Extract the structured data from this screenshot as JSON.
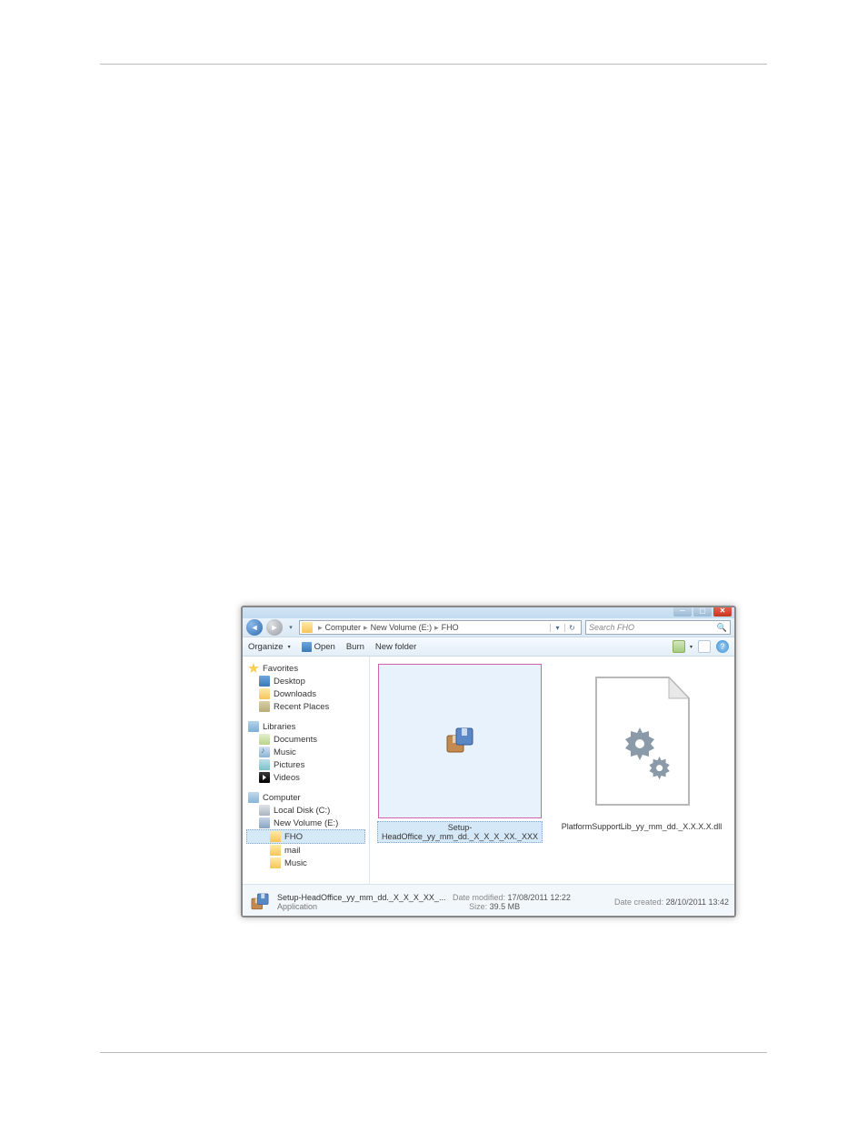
{
  "window": {
    "breadcrumb": [
      "Computer",
      "New Volume (E:)",
      "FHO"
    ]
  },
  "search": {
    "placeholder": "Search FHO"
  },
  "toolbar": {
    "organize": "Organize",
    "open": "Open",
    "burn": "Burn",
    "new_folder": "New folder"
  },
  "nav": {
    "favorites": "Favorites",
    "fav_items": [
      "Desktop",
      "Downloads",
      "Recent Places"
    ],
    "libraries": "Libraries",
    "lib_items": [
      "Documents",
      "Music",
      "Pictures",
      "Videos"
    ],
    "computer": "Computer",
    "comp_items": [
      "Local Disk (C:)",
      "New Volume (E:)"
    ],
    "comp_sub": [
      "FHO",
      "mail",
      "Music"
    ]
  },
  "files": {
    "item0": {
      "name": "Setup-HeadOffice_yy_mm_dd._X_X_X_XX._XXX"
    },
    "item1": {
      "name": "PlatformSupportLib_yy_mm_dd._X.X.X.X.dll"
    }
  },
  "details": {
    "title": "Setup-HeadOffice_yy_mm_dd._X_X_X_XX_...",
    "type": "Application",
    "modified_label": "Date modified:",
    "modified": "17/08/2011 12:22",
    "size_label": "Size:",
    "size": "39.5 MB",
    "created_label": "Date created:",
    "created": "28/10/2011 13:42"
  }
}
